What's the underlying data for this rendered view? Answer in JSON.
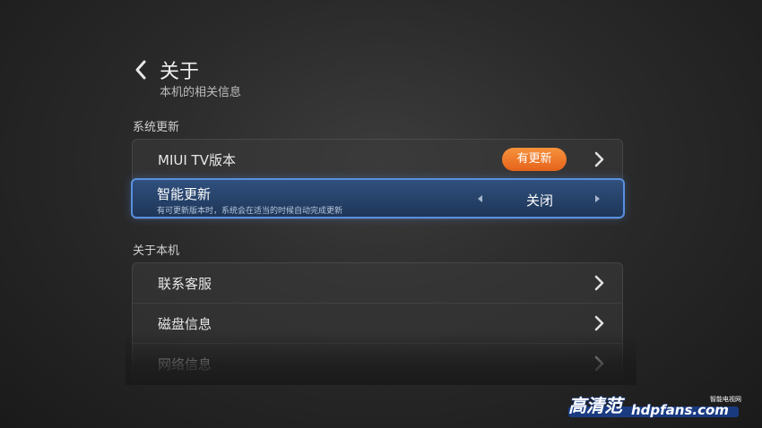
{
  "header": {
    "title": "关于",
    "subtitle": "本机的相关信息"
  },
  "sections": [
    {
      "label": "系统更新",
      "items": [
        {
          "label": "MIUI TV版本",
          "badge": "有更新"
        },
        {
          "label": "智能更新",
          "description": "有可更新版本时，系统会在适当的时候自动完成更新",
          "value": "关闭",
          "focused": true
        }
      ]
    },
    {
      "label": "关于本机",
      "items": [
        {
          "label": "联系客服"
        },
        {
          "label": "磁盘信息"
        },
        {
          "label": "网络信息"
        }
      ]
    }
  ],
  "watermark": {
    "logo_text": "高清范",
    "url": "hdpfans.com",
    "tagline": "智能电视网"
  },
  "colors": {
    "badge": "#f07a2a",
    "focus_border": "#5a8fe0",
    "focus_bg": "#28456f"
  },
  "icons": {
    "back": "chevron-left-icon",
    "row_arrow": "chevron-right-icon",
    "value_prev": "triangle-left-icon",
    "value_next": "triangle-right-icon"
  }
}
